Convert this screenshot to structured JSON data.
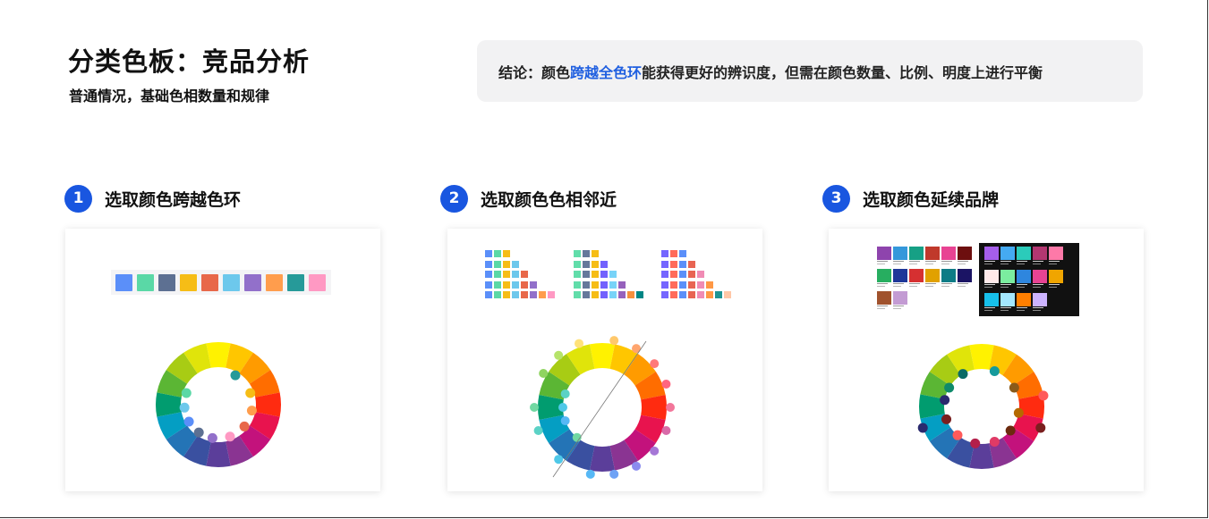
{
  "header": {
    "title": "分类色板：竞品分析",
    "subtitle": "普通情况，基础色相数量和规律"
  },
  "conclusion": {
    "prefix": "结论：颜色",
    "highlight": "跨越全色环",
    "suffix": "能获得更好的辨识度，但需在颜色数量、比例、明度上进行平衡",
    "highlight_color": "#1f5fe0"
  },
  "steps": [
    {
      "num": "1",
      "label": "选取颜色跨越色环"
    },
    {
      "num": "2",
      "label": "选取颜色色相邻近"
    },
    {
      "num": "3",
      "label": "选取颜色延续品牌"
    }
  ],
  "colors": {
    "accent": "#1956e0",
    "wheel": [
      "#fff200",
      "#ffc600",
      "#ff9b00",
      "#ff6d00",
      "#ff2b10",
      "#e8134e",
      "#c3127c",
      "#8a3492",
      "#5b3e9a",
      "#3a50a0",
      "#2474b6",
      "#049ec3",
      "#019c6f",
      "#5bb634",
      "#a8cc14",
      "#e0e40a"
    ],
    "card1_swatches": [
      "#5b8ff9",
      "#5ad8a6",
      "#5d7092",
      "#f6bd16",
      "#e8684a",
      "#6dc8ec",
      "#9270ca",
      "#ff9d4d",
      "#269a99",
      "#ff99c3"
    ],
    "card1_markers": [
      "#5ad8a6",
      "#6dc8ec",
      "#5b8ff9",
      "#5d7092",
      "#9270ca",
      "#ff99c3",
      "#e8684a",
      "#ff9d4d",
      "#f6bd16",
      "#269a99"
    ],
    "card2_markers": [
      "#8fd460",
      "#b6e36a",
      "#ffe27a",
      "#ffc86b",
      "#ffa56e",
      "#ff7a7a",
      "#ff6680",
      "#f2769a",
      "#d86aa8",
      "#a577d6",
      "#8a8bee",
      "#6ea2f5",
      "#57b8f5",
      "#4fc8e8",
      "#5bd2c6",
      "#71d8a2"
    ],
    "card3_markers": [
      "#0e8a6a",
      "#0b6b66",
      "#159a9c",
      "#8a5a1a",
      "#b56a00",
      "#6b2a0e",
      "#e03a66",
      "#b41f4a",
      "#ff5a5a",
      "#7a1f1f",
      "#2a2a6e",
      "#1f3a8a",
      "#2f7ad8",
      "#a07af0",
      "#e34d8e",
      "#2a2a2a"
    ]
  }
}
